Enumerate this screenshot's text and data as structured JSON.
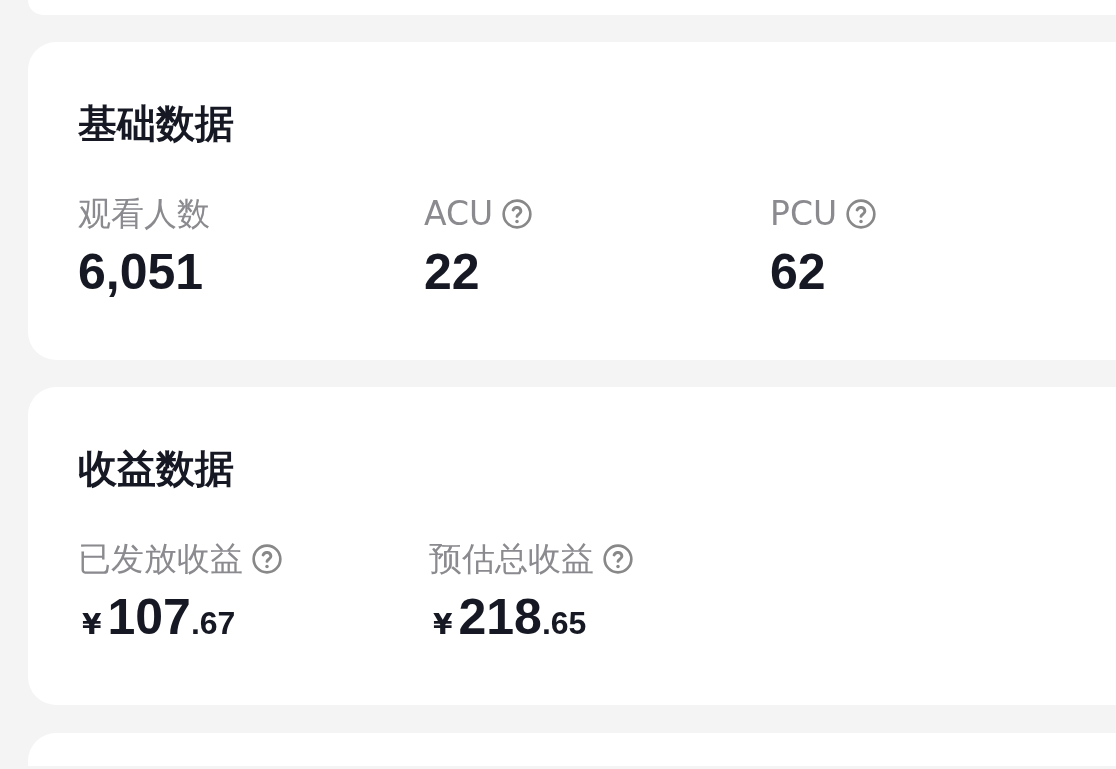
{
  "sections": [
    {
      "title": "基础数据",
      "metrics": [
        {
          "kind": "count",
          "label": "观看人数",
          "help": false,
          "value": "6,051"
        },
        {
          "kind": "count",
          "label": "ACU",
          "help": true,
          "value": "22"
        },
        {
          "kind": "count",
          "label": "PCU",
          "help": true,
          "value": "62"
        }
      ]
    },
    {
      "title": "收益数据",
      "metrics": [
        {
          "kind": "money",
          "label": "已发放收益",
          "help": true,
          "currency": "¥",
          "integer": "107",
          "decimal": ".67"
        },
        {
          "kind": "money",
          "label": "预估总收益",
          "help": true,
          "currency": "¥",
          "integer": "218",
          "decimal": ".65"
        }
      ]
    }
  ]
}
